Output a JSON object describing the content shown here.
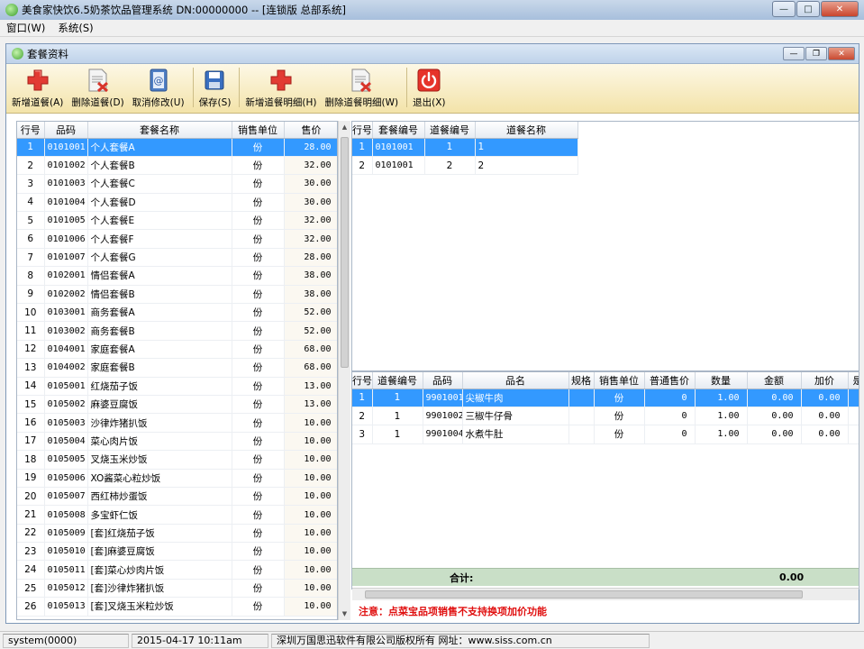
{
  "window": {
    "title": "美食家快饮6.5奶茶饮品管理系统 DN:00000000 -- [连锁版 总部系统]"
  },
  "menu": [
    "窗口(W)",
    "系统(S)"
  ],
  "child_window": {
    "title": "套餐资料"
  },
  "toolbar": [
    {
      "label": "新增道餐(A)",
      "icon": "add-icon"
    },
    {
      "label": "删除道餐(D)",
      "icon": "delete-doc-icon"
    },
    {
      "label": "取消修改(U)",
      "icon": "cancel-edit-icon"
    },
    {
      "label": "保存(S)",
      "icon": "save-icon"
    },
    {
      "label": "新增道餐明细(H)",
      "icon": "add-icon"
    },
    {
      "label": "删除道餐明细(W)",
      "icon": "delete-doc-icon"
    },
    {
      "label": "退出(X)",
      "icon": "power-icon"
    }
  ],
  "packages": {
    "columns": [
      "行号",
      "品码",
      "套餐名称",
      "销售单位",
      "售价"
    ],
    "rows": [
      [
        "1",
        "0101001",
        "个人套餐A",
        "份",
        "28.00"
      ],
      [
        "2",
        "0101002",
        "个人套餐B",
        "份",
        "32.00"
      ],
      [
        "3",
        "0101003",
        "个人套餐C",
        "份",
        "30.00"
      ],
      [
        "4",
        "0101004",
        "个人套餐D",
        "份",
        "30.00"
      ],
      [
        "5",
        "0101005",
        "个人套餐E",
        "份",
        "32.00"
      ],
      [
        "6",
        "0101006",
        "个人套餐F",
        "份",
        "32.00"
      ],
      [
        "7",
        "0101007",
        "个人套餐G",
        "份",
        "28.00"
      ],
      [
        "8",
        "0102001",
        "情侣套餐A",
        "份",
        "38.00"
      ],
      [
        "9",
        "0102002",
        "情侣套餐B",
        "份",
        "38.00"
      ],
      [
        "10",
        "0103001",
        "商务套餐A",
        "份",
        "52.00"
      ],
      [
        "11",
        "0103002",
        "商务套餐B",
        "份",
        "52.00"
      ],
      [
        "12",
        "0104001",
        "家庭套餐A",
        "份",
        "68.00"
      ],
      [
        "13",
        "0104002",
        "家庭套餐B",
        "份",
        "68.00"
      ],
      [
        "14",
        "0105001",
        "红烧茄子饭",
        "份",
        "13.00"
      ],
      [
        "15",
        "0105002",
        "麻婆豆腐饭",
        "份",
        "13.00"
      ],
      [
        "16",
        "0105003",
        "沙律炸猪扒饭",
        "份",
        "10.00"
      ],
      [
        "17",
        "0105004",
        "菜心肉片饭",
        "份",
        "10.00"
      ],
      [
        "18",
        "0105005",
        "叉烧玉米炒饭",
        "份",
        "10.00"
      ],
      [
        "19",
        "0105006",
        "XO酱菜心粒炒饭",
        "份",
        "10.00"
      ],
      [
        "20",
        "0105007",
        "西红柿炒蛋饭",
        "份",
        "10.00"
      ],
      [
        "21",
        "0105008",
        "多宝虾仁饭",
        "份",
        "10.00"
      ],
      [
        "22",
        "0105009",
        "[套]红烧茄子饭",
        "份",
        "10.00"
      ],
      [
        "23",
        "0105010",
        "[套]麻婆豆腐饭",
        "份",
        "10.00"
      ],
      [
        "24",
        "0105011",
        "[套]菜心炒肉片饭",
        "份",
        "10.00"
      ],
      [
        "25",
        "0105012",
        "[套]沙律炸猪扒饭",
        "份",
        "10.00"
      ],
      [
        "26",
        "0105013",
        "[套]叉烧玉米粒炒饭",
        "份",
        "10.00"
      ]
    ]
  },
  "courses": {
    "columns": [
      "行号",
      "套餐编号",
      "道餐编号",
      "道餐名称"
    ],
    "rows": [
      [
        "1",
        "0101001",
        "1",
        "1"
      ],
      [
        "2",
        "0101001",
        "2",
        "2"
      ]
    ]
  },
  "details": {
    "columns": [
      "行号",
      "道餐编号",
      "品码",
      "品名",
      "规格",
      "销售单位",
      "普通售价",
      "数量",
      "金额",
      "加价",
      "是"
    ],
    "rows": [
      [
        "1",
        "1",
        "9901001",
        "尖椒牛肉",
        "",
        "份",
        "0",
        "1.00",
        "0.00",
        "0.00"
      ],
      [
        "2",
        "1",
        "9901002",
        "三椒牛仔骨",
        "",
        "份",
        "0",
        "1.00",
        "0.00",
        "0.00"
      ],
      [
        "3",
        "1",
        "9901004",
        "水煮牛肚",
        "",
        "份",
        "0",
        "1.00",
        "0.00",
        "0.00"
      ]
    ],
    "total_label": "合计:",
    "total_amount": "0.00"
  },
  "notice": "注意：点菜宝品项销售不支持换项加价功能",
  "status": {
    "user": "system(0000)",
    "datetime": "2015-04-17 10:11am",
    "copyright": "深圳万国思迅软件有限公司版权所有 网址：www.siss.com.cn"
  },
  "colors": {
    "selection": "#3399ff",
    "toolbar_bg": "#f3e3a9",
    "total_row_bg": "#c9dfc7",
    "notice": "#e01010"
  }
}
